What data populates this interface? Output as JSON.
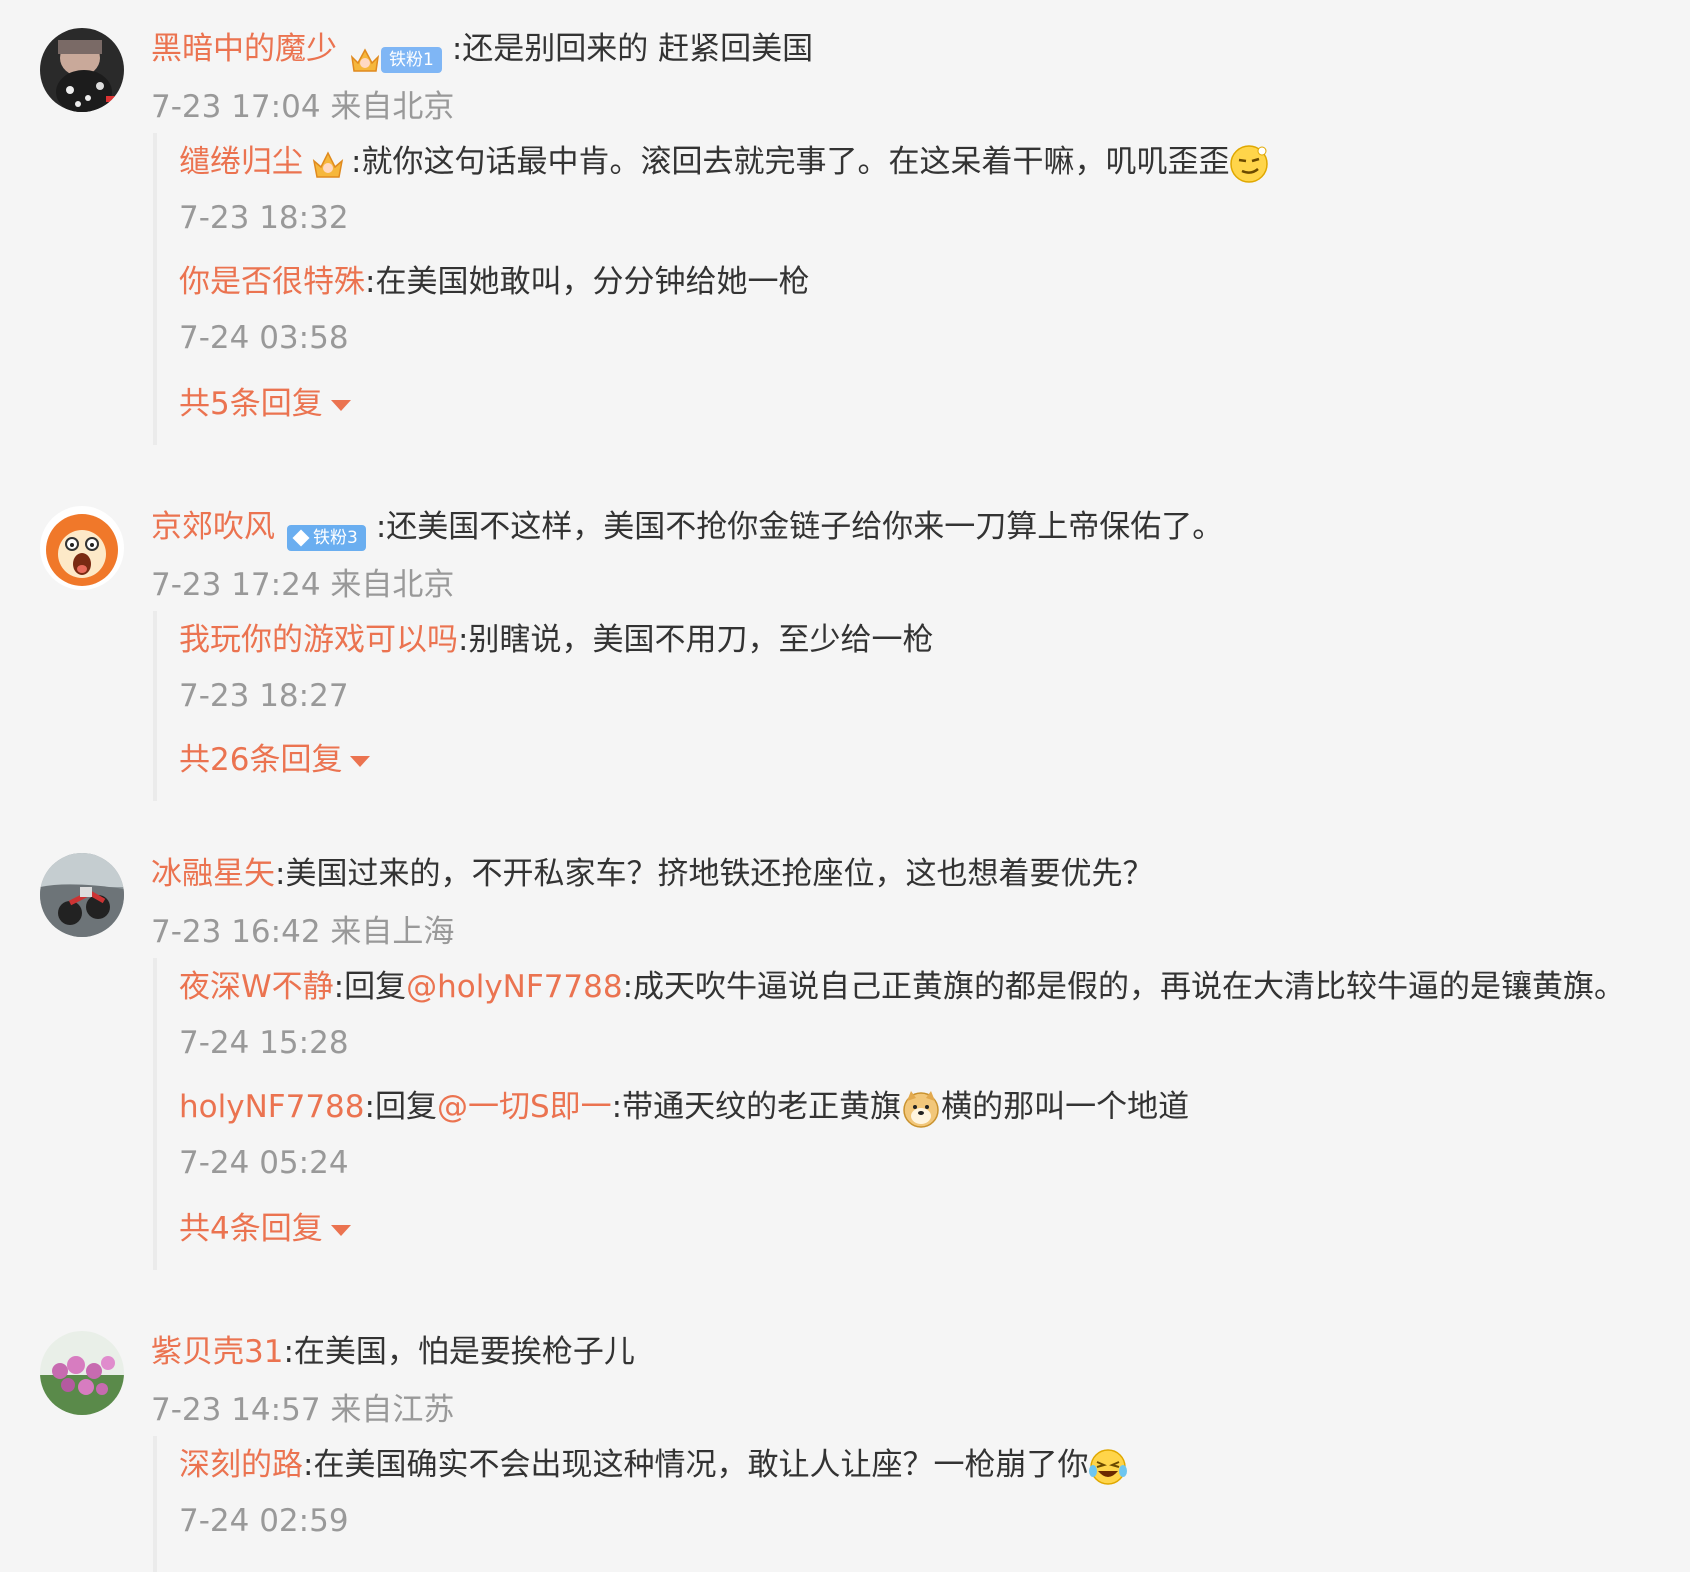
{
  "comments": [
    {
      "user": "黑暗中的魔少",
      "badge": "铁粉1",
      "text": ":还是别回来的  赶紧回美国",
      "meta": "7-23 17:04 来自北京",
      "replies": [
        {
          "user": "缱绻归尘",
          "text": ":就你这句话最中肯。滚回去就完事了。在这呆着干嘛，叽叽歪歪",
          "time": "7-23 18:32",
          "emoji": "smirk-emoji"
        },
        {
          "user": "你是否很特殊",
          "text": ":在美国她敢叫，分分钟给她一枪",
          "time": "7-24 03:58"
        }
      ],
      "more": "共5条回复"
    },
    {
      "user": "京郊吹风",
      "badge": "铁粉3",
      "text": ":还美国不这样，美国不抢你金链子给你来一刀算上帝保佑了。",
      "meta": "7-23 17:24 来自北京",
      "replies": [
        {
          "user": "我玩你的游戏可以吗",
          "text": ":别瞎说，美国不用刀，至少给一枪",
          "time": "7-23 18:27"
        }
      ],
      "more": "共26条回复"
    },
    {
      "user": "冰融星矢",
      "text": ":美国过来的，不开私家车？挤地铁还抢座位，这也想着要优先？",
      "meta": "7-23 16:42 来自上海",
      "replies": [
        {
          "user": "夜深W不静",
          "prefix": ":回复",
          "mention": "@holyNF7788",
          "text": ":成天吹牛逼说自己正黄旗的都是假的，再说在大清比较牛逼的是镶黄旗。",
          "time": "7-24 15:28"
        },
        {
          "user": "holyNF7788",
          "prefix": ":回复",
          "mention": "@一切S即一",
          "text": ":带通天纹的老正黄旗",
          "text2": "横的那叫一个地道",
          "time": "7-24 05:24",
          "emoji": "doge-emoji"
        }
      ],
      "more": "共4条回复"
    },
    {
      "user": "紫贝壳31",
      "text": ":在美国，怕是要挨枪子儿",
      "meta": "7-23 14:57 来自江苏",
      "replies": [
        {
          "user": "深刻的路",
          "text": ":在美国确实不会出现这种情况，敢让人让座？一枪崩了你",
          "time": "7-24 02:59",
          "emoji": "laugh-cry-emoji"
        }
      ]
    }
  ],
  "colors": {
    "name": "#eb7350",
    "text": "#333333",
    "meta": "#999999",
    "background": "#f5f5f5"
  }
}
